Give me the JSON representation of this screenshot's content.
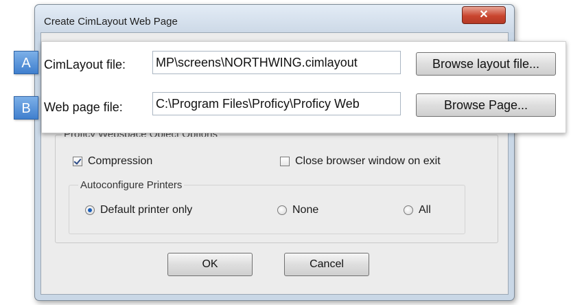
{
  "window": {
    "title": "Create CimLayout Web Page",
    "close_glyph": "✕"
  },
  "callout": {
    "marker_a": "A",
    "marker_b": "B",
    "layout_label": "CimLayout file:",
    "layout_value": "MP\\screens\\NORTHWING.cimlayout",
    "browse_layout_button": "Browse layout file...",
    "web_label": "Web page file:",
    "web_value": "C:\\Program Files\\Proficy\\Proficy Web",
    "browse_page_button": "Browse Page..."
  },
  "options": {
    "group_label": "Proficy Webspace Object Options",
    "compression_label": "Compression",
    "compression_checked": true,
    "close_browser_label": "Close browser window on exit",
    "close_browser_checked": false,
    "printers_label": "Autoconfigure Printers",
    "radios": [
      {
        "label": "Default printer only",
        "selected": true
      },
      {
        "label": "None",
        "selected": false
      },
      {
        "label": "All",
        "selected": false
      }
    ]
  },
  "buttons": {
    "ok": "OK",
    "cancel": "Cancel"
  },
  "colors": {
    "marker_blue": "#3f7fce",
    "close_red": "#c9452f",
    "window_frame": "#c9d7e6"
  }
}
